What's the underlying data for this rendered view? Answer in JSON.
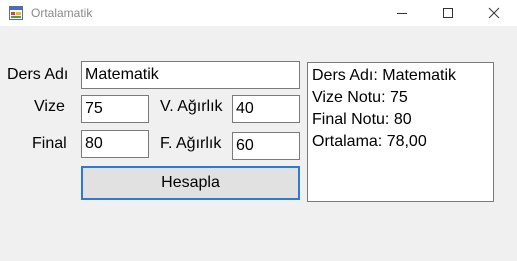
{
  "window": {
    "title": "Ortalamatik",
    "icon": "winforms-app-icon",
    "controls": [
      "minimize-icon",
      "maximize-icon",
      "close-icon"
    ]
  },
  "form": {
    "course_label": "Ders Adı",
    "course_value": "Matematik",
    "midterm_label": "Vize",
    "midterm_value": "75",
    "midterm_weight_label": "V. Ağırlık",
    "midterm_weight_value": "40",
    "final_label": "Final",
    "final_value": "80",
    "final_weight_label": "F. Ağırlık",
    "final_weight_value": "60",
    "calculate_button": "Hesapla"
  },
  "output": {
    "lines": [
      "Ders Adı: Matematik",
      "Vize Notu: 75",
      "Final Notu: 80",
      "Ortalama: 78,00"
    ]
  }
}
